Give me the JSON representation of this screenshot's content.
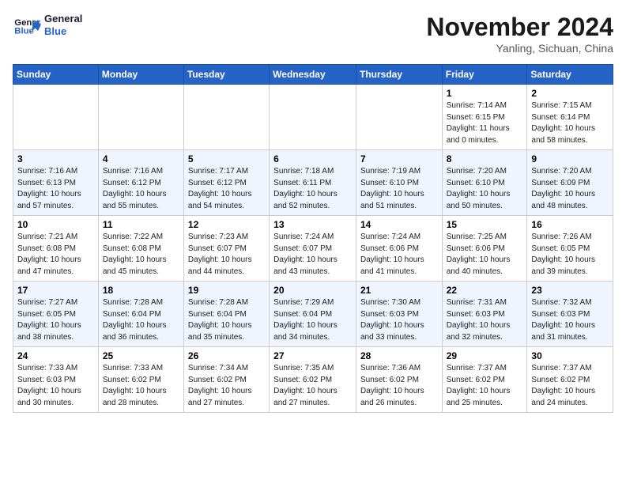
{
  "logo": {
    "line1": "General",
    "line2": "Blue"
  },
  "title": "November 2024",
  "subtitle": "Yanling, Sichuan, China",
  "days_of_week": [
    "Sunday",
    "Monday",
    "Tuesday",
    "Wednesday",
    "Thursday",
    "Friday",
    "Saturday"
  ],
  "weeks": [
    [
      {
        "day": "",
        "info": ""
      },
      {
        "day": "",
        "info": ""
      },
      {
        "day": "",
        "info": ""
      },
      {
        "day": "",
        "info": ""
      },
      {
        "day": "",
        "info": ""
      },
      {
        "day": "1",
        "info": "Sunrise: 7:14 AM\nSunset: 6:15 PM\nDaylight: 11 hours and 0 minutes."
      },
      {
        "day": "2",
        "info": "Sunrise: 7:15 AM\nSunset: 6:14 PM\nDaylight: 10 hours and 58 minutes."
      }
    ],
    [
      {
        "day": "3",
        "info": "Sunrise: 7:16 AM\nSunset: 6:13 PM\nDaylight: 10 hours and 57 minutes."
      },
      {
        "day": "4",
        "info": "Sunrise: 7:16 AM\nSunset: 6:12 PM\nDaylight: 10 hours and 55 minutes."
      },
      {
        "day": "5",
        "info": "Sunrise: 7:17 AM\nSunset: 6:12 PM\nDaylight: 10 hours and 54 minutes."
      },
      {
        "day": "6",
        "info": "Sunrise: 7:18 AM\nSunset: 6:11 PM\nDaylight: 10 hours and 52 minutes."
      },
      {
        "day": "7",
        "info": "Sunrise: 7:19 AM\nSunset: 6:10 PM\nDaylight: 10 hours and 51 minutes."
      },
      {
        "day": "8",
        "info": "Sunrise: 7:20 AM\nSunset: 6:10 PM\nDaylight: 10 hours and 50 minutes."
      },
      {
        "day": "9",
        "info": "Sunrise: 7:20 AM\nSunset: 6:09 PM\nDaylight: 10 hours and 48 minutes."
      }
    ],
    [
      {
        "day": "10",
        "info": "Sunrise: 7:21 AM\nSunset: 6:08 PM\nDaylight: 10 hours and 47 minutes."
      },
      {
        "day": "11",
        "info": "Sunrise: 7:22 AM\nSunset: 6:08 PM\nDaylight: 10 hours and 45 minutes."
      },
      {
        "day": "12",
        "info": "Sunrise: 7:23 AM\nSunset: 6:07 PM\nDaylight: 10 hours and 44 minutes."
      },
      {
        "day": "13",
        "info": "Sunrise: 7:24 AM\nSunset: 6:07 PM\nDaylight: 10 hours and 43 minutes."
      },
      {
        "day": "14",
        "info": "Sunrise: 7:24 AM\nSunset: 6:06 PM\nDaylight: 10 hours and 41 minutes."
      },
      {
        "day": "15",
        "info": "Sunrise: 7:25 AM\nSunset: 6:06 PM\nDaylight: 10 hours and 40 minutes."
      },
      {
        "day": "16",
        "info": "Sunrise: 7:26 AM\nSunset: 6:05 PM\nDaylight: 10 hours and 39 minutes."
      }
    ],
    [
      {
        "day": "17",
        "info": "Sunrise: 7:27 AM\nSunset: 6:05 PM\nDaylight: 10 hours and 38 minutes."
      },
      {
        "day": "18",
        "info": "Sunrise: 7:28 AM\nSunset: 6:04 PM\nDaylight: 10 hours and 36 minutes."
      },
      {
        "day": "19",
        "info": "Sunrise: 7:28 AM\nSunset: 6:04 PM\nDaylight: 10 hours and 35 minutes."
      },
      {
        "day": "20",
        "info": "Sunrise: 7:29 AM\nSunset: 6:04 PM\nDaylight: 10 hours and 34 minutes."
      },
      {
        "day": "21",
        "info": "Sunrise: 7:30 AM\nSunset: 6:03 PM\nDaylight: 10 hours and 33 minutes."
      },
      {
        "day": "22",
        "info": "Sunrise: 7:31 AM\nSunset: 6:03 PM\nDaylight: 10 hours and 32 minutes."
      },
      {
        "day": "23",
        "info": "Sunrise: 7:32 AM\nSunset: 6:03 PM\nDaylight: 10 hours and 31 minutes."
      }
    ],
    [
      {
        "day": "24",
        "info": "Sunrise: 7:33 AM\nSunset: 6:03 PM\nDaylight: 10 hours and 30 minutes."
      },
      {
        "day": "25",
        "info": "Sunrise: 7:33 AM\nSunset: 6:02 PM\nDaylight: 10 hours and 28 minutes."
      },
      {
        "day": "26",
        "info": "Sunrise: 7:34 AM\nSunset: 6:02 PM\nDaylight: 10 hours and 27 minutes."
      },
      {
        "day": "27",
        "info": "Sunrise: 7:35 AM\nSunset: 6:02 PM\nDaylight: 10 hours and 27 minutes."
      },
      {
        "day": "28",
        "info": "Sunrise: 7:36 AM\nSunset: 6:02 PM\nDaylight: 10 hours and 26 minutes."
      },
      {
        "day": "29",
        "info": "Sunrise: 7:37 AM\nSunset: 6:02 PM\nDaylight: 10 hours and 25 minutes."
      },
      {
        "day": "30",
        "info": "Sunrise: 7:37 AM\nSunset: 6:02 PM\nDaylight: 10 hours and 24 minutes."
      }
    ]
  ]
}
